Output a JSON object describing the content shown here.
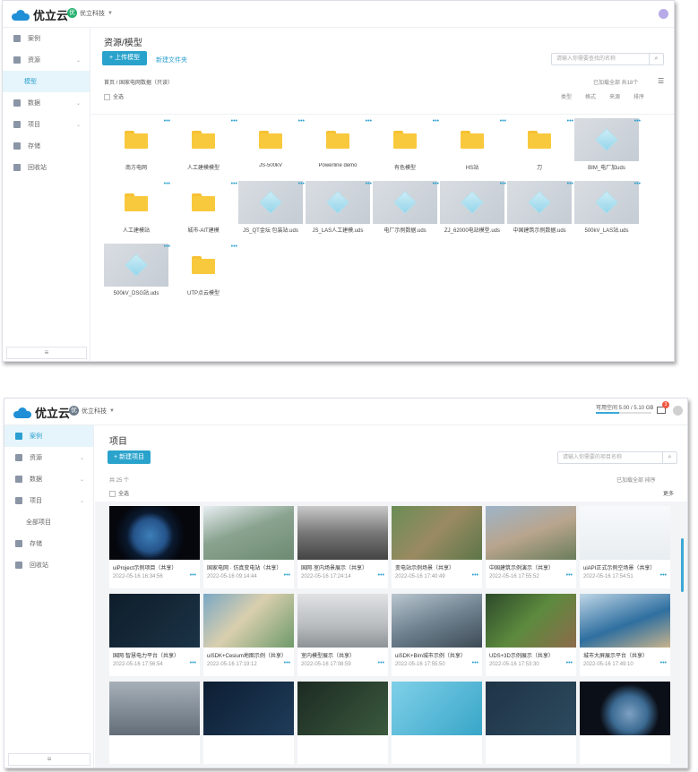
{
  "brand": "优立云",
  "win1": {
    "project": "优立科技",
    "sidebar": [
      {
        "label": "案例",
        "icon": "folder-icon"
      },
      {
        "label": "资源",
        "icon": "resource-icon",
        "expanded": true
      },
      {
        "label": "模型",
        "sub": true,
        "active": true
      },
      {
        "label": "数据",
        "icon": "cloud-icon"
      },
      {
        "label": "项目",
        "icon": "project-icon"
      },
      {
        "label": "存储",
        "icon": "storage-icon"
      },
      {
        "label": "回收站",
        "icon": "trash-icon"
      }
    ],
    "title": "资源/模型",
    "upload": "+ 上传模型",
    "new_folder": "新建文件夹",
    "search_placeholder": "请输入你需要查找的名称",
    "breadcrumb": "首页 / 国家电网数据（只读）",
    "select_all": "全选",
    "info_right": "已加载全部  共18个",
    "filters": [
      "类型",
      "格式",
      "来源",
      "排序"
    ],
    "items": [
      {
        "name": "南方电网",
        "type": "folder"
      },
      {
        "name": "人工建模模型",
        "type": "folder"
      },
      {
        "name": "JS-500kV",
        "type": "folder"
      },
      {
        "name": "Powerline demo",
        "type": "folder"
      },
      {
        "name": "有色模型",
        "type": "folder"
      },
      {
        "name": "HS站",
        "type": "folder"
      },
      {
        "name": "刀",
        "type": "folder"
      },
      {
        "name": "BIM_电厂加uds",
        "type": "model"
      },
      {
        "name": "人工建模站",
        "type": "folder"
      },
      {
        "name": "城市-AIT建模",
        "type": "folder"
      },
      {
        "name": "JS_QT金坛 包装站.uds",
        "type": "model"
      },
      {
        "name": "JS_LAS人工建模.uds",
        "type": "model"
      },
      {
        "name": "电厂示例数据.uds",
        "type": "model"
      },
      {
        "name": "ZJ_62000电站模型.uds",
        "type": "model"
      },
      {
        "name": "中国建筑示例数据.uds",
        "type": "model"
      },
      {
        "name": "500kV_LAS站.uds",
        "type": "model"
      },
      {
        "name": "500kV_DSG站.uds",
        "type": "model"
      },
      {
        "name": "UTP点云模型",
        "type": "folder"
      }
    ]
  },
  "win2": {
    "project": "优立科技",
    "storage": "可用空间 5.00 / 5.10 GB",
    "badge": "3",
    "sidebar": [
      {
        "label": "案例",
        "icon": "folder-icon",
        "active": true
      },
      {
        "label": "资源",
        "icon": "resource-icon"
      },
      {
        "label": "数据",
        "icon": "cloud-icon"
      },
      {
        "label": "项目",
        "icon": "project-icon"
      },
      {
        "label": "全部项目",
        "sub": true
      },
      {
        "label": "存储",
        "icon": "storage-icon"
      },
      {
        "label": "回收站",
        "icon": "trash-icon"
      }
    ],
    "title": "项目",
    "new_project": "+ 新建项目",
    "search_placeholder": "请输入你需要的项目名称",
    "count": "共 25 个",
    "info_right": "已加载全部  排序",
    "select_all": "全选",
    "more": "更多",
    "cards": [
      {
        "title": "uiProject示例项目（共享）",
        "date": "2022-05-16 16:34:56",
        "img": "earth"
      },
      {
        "title": "国家电网 · 仿真变电站（共享）",
        "date": "2022-05-16 09:14:44",
        "img": "substation"
      },
      {
        "title": "国网·室内场景展示（共享）",
        "date": "2022-05-16 17:24:14",
        "img": "indoor"
      },
      {
        "title": "变电站示例场景（共享）",
        "date": "2022-05-16 17:40:49",
        "img": "aerial"
      },
      {
        "title": "中国建筑示例演示（共享）",
        "date": "2022-05-16 17:55:52",
        "img": "buildings"
      },
      {
        "title": "uiAPI正式示例空场景（共享）",
        "date": "2022-05-16 17:54:51",
        "img": "docs"
      },
      {
        "title": "国网·智慧电力平台（共享）",
        "date": "2022-05-16 17:56:54",
        "img": "dark"
      },
      {
        "title": "uiSDK+Cesium地图示例（共享）",
        "date": "2022-05-16 17:19:12",
        "img": "coast"
      },
      {
        "title": "室内模型展示（共享）",
        "date": "2022-05-16 17:08:59",
        "img": "room"
      },
      {
        "title": "uiSDK+Bim城市示例（共享）",
        "date": "2022-05-16 17:55:50",
        "img": "city"
      },
      {
        "title": "UDS+3D示例展示（共享）",
        "date": "2022-05-16 17:53:30",
        "img": "green"
      },
      {
        "title": "城市大屏展示平台（共享）",
        "date": "2022-05-16 17:49:10",
        "img": "coastcity"
      },
      {
        "title": "",
        "date": "",
        "img": "citygrey"
      },
      {
        "title": "",
        "date": "",
        "img": "dashboard"
      },
      {
        "title": "",
        "date": "",
        "img": "dashboard2"
      },
      {
        "title": "",
        "date": "",
        "img": "cube"
      },
      {
        "title": "",
        "date": "",
        "img": "login"
      },
      {
        "title": "",
        "date": "",
        "img": "earth2"
      }
    ]
  }
}
